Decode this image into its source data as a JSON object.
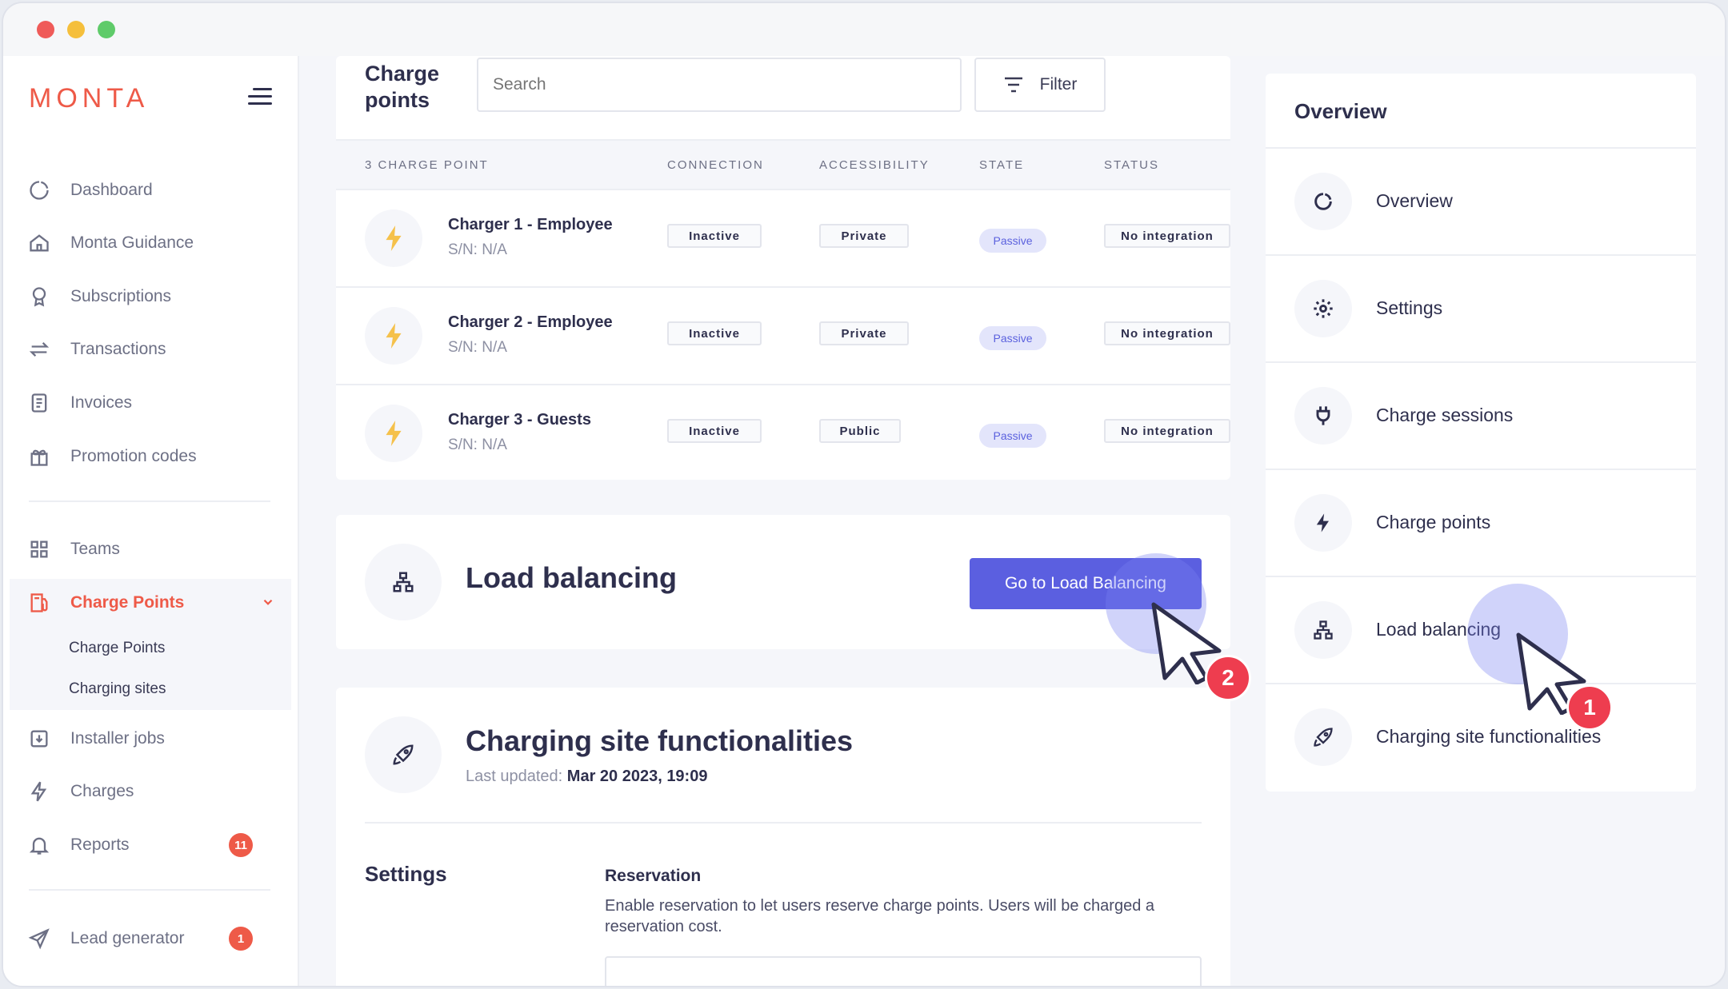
{
  "sidebar": {
    "logo": "MONTA",
    "items": [
      {
        "label": "Dashboard",
        "icon": "dashboard-icon"
      },
      {
        "label": "Monta Guidance",
        "icon": "home-icon"
      },
      {
        "label": "Subscriptions",
        "icon": "award-icon"
      },
      {
        "label": "Transactions",
        "icon": "arrows-icon"
      },
      {
        "label": "Invoices",
        "icon": "invoice-icon"
      },
      {
        "label": "Promotion codes",
        "icon": "gift-icon"
      },
      {
        "label": "Teams",
        "icon": "grid-icon"
      },
      {
        "label": "Charge Points",
        "icon": "fuel-icon"
      },
      {
        "label": "Installer jobs",
        "icon": "download-icon"
      },
      {
        "label": "Charges",
        "icon": "bolt-icon"
      },
      {
        "label": "Reports",
        "icon": "bell-icon",
        "badge": "11"
      },
      {
        "label": "Lead generator",
        "icon": "send-icon",
        "badge": "1"
      }
    ],
    "sub_items": [
      "Charge Points",
      "Charging sites"
    ]
  },
  "charge_points": {
    "title": "Charge points",
    "search_placeholder": "Search",
    "filter_label": "Filter",
    "columns": [
      "3 CHARGE POINT",
      "CONNECTION",
      "ACCESSIBILITY",
      "STATE",
      "STATUS"
    ],
    "rows": [
      {
        "name": "Charger 1 - Employee",
        "sn": "S/N: N/A",
        "connection": "Inactive",
        "accessibility": "Private",
        "state": "Passive",
        "status": "No integration"
      },
      {
        "name": "Charger 2 - Employee",
        "sn": "S/N: N/A",
        "connection": "Inactive",
        "accessibility": "Private",
        "state": "Passive",
        "status": "No integration"
      },
      {
        "name": "Charger 3 - Guests",
        "sn": "S/N: N/A",
        "connection": "Inactive",
        "accessibility": "Public",
        "state": "Passive",
        "status": "No integration"
      }
    ]
  },
  "load_balancing": {
    "title": "Load balancing",
    "button": "Go to Load Balancing",
    "step": "2"
  },
  "site_functionalities": {
    "title": "Charging site functionalities",
    "updated_label": "Last updated:",
    "updated_value": "Mar 20 2023, 19:09",
    "settings_label": "Settings",
    "reservation_title": "Reservation",
    "reservation_desc": "Enable reservation to let users reserve charge points. Users will be charged a reservation cost."
  },
  "overview_panel": {
    "title": "Overview",
    "items": [
      {
        "label": "Overview",
        "icon": "refresh-icon"
      },
      {
        "label": "Settings",
        "icon": "gear-icon"
      },
      {
        "label": "Charge sessions",
        "icon": "plug-icon"
      },
      {
        "label": "Charge points",
        "icon": "bolt-icon"
      },
      {
        "label": "Load balancing",
        "icon": "hierarchy-icon"
      },
      {
        "label": "Charging site functionalities",
        "icon": "rocket-icon"
      }
    ],
    "step": "1"
  },
  "colors": {
    "brand": "#ee5a48",
    "accent": "#5b5fe0",
    "step_badge": "#ee3d4f"
  }
}
